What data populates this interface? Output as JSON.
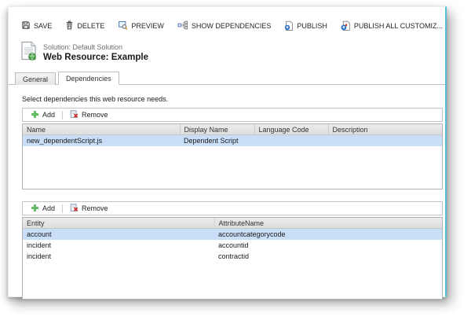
{
  "window": {
    "command_bar": {
      "items": [
        {
          "label": "SAVE"
        },
        {
          "label": "DELETE"
        },
        {
          "label": "PREVIEW"
        },
        {
          "label": "SHOW DEPENDENCIES"
        },
        {
          "label": "PUBLISH"
        },
        {
          "label": "PUBLISH ALL CUSTOMIZ..."
        }
      ]
    },
    "header": {
      "solution_label": "Solution: Default Solution",
      "title": "Web Resource: Example"
    },
    "tabs": [
      {
        "label": "General",
        "active": false
      },
      {
        "label": "Dependencies",
        "active": true
      }
    ],
    "instruction": "Select dependencies this web resource needs.",
    "grid_toolbar": {
      "add_label": "Add",
      "remove_label": "Remove"
    },
    "dependency_grid": {
      "columns": [
        "Name",
        "Display Name",
        "Language Code",
        "Description"
      ],
      "rows": [
        {
          "cells": [
            "new_dependentScript.js",
            "Dependent Script",
            "",
            ""
          ],
          "selected": true
        }
      ]
    },
    "attribute_grid": {
      "columns": [
        "Entity",
        "AttributeName"
      ],
      "rows": [
        {
          "cells": [
            "account",
            "accountcategorycode"
          ],
          "selected": true
        },
        {
          "cells": [
            "incident",
            "accountid"
          ],
          "selected": false
        },
        {
          "cells": [
            "incident",
            "contractid"
          ],
          "selected": false
        }
      ]
    },
    "colors": {
      "selection_blue": "#c9def7",
      "header_gray": "#e3e3e3",
      "accent_teal": "#4fc6d8",
      "add_green": "#3fa93f",
      "remove_red": "#cc2222"
    }
  }
}
